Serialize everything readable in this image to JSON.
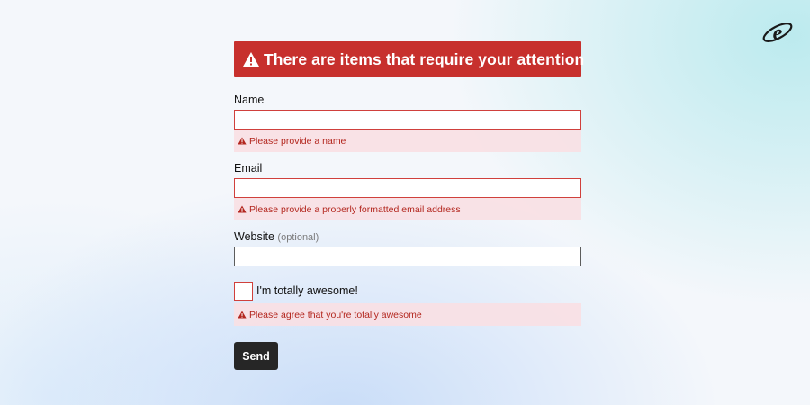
{
  "alert": {
    "message": "There are items that require your attention"
  },
  "form": {
    "name": {
      "label": "Name",
      "value": "",
      "error": "Please provide a name"
    },
    "email": {
      "label": "Email",
      "value": "",
      "error": "Please provide a properly formatted email address"
    },
    "website": {
      "label": "Website",
      "optional_hint": "(optional)",
      "value": ""
    },
    "awesome": {
      "label": "I'm totally awesome!",
      "checked": false,
      "error": "Please agree that you're totally awesome"
    },
    "submit_label": "Send"
  },
  "icons": {
    "logo": "e-logo-icon",
    "alert": "warning-triangle-icon"
  },
  "colors": {
    "error_red": "#c7302d",
    "error_text": "#b3261e",
    "error_bg": "#f8e0e4",
    "button_bg": "#262626"
  }
}
